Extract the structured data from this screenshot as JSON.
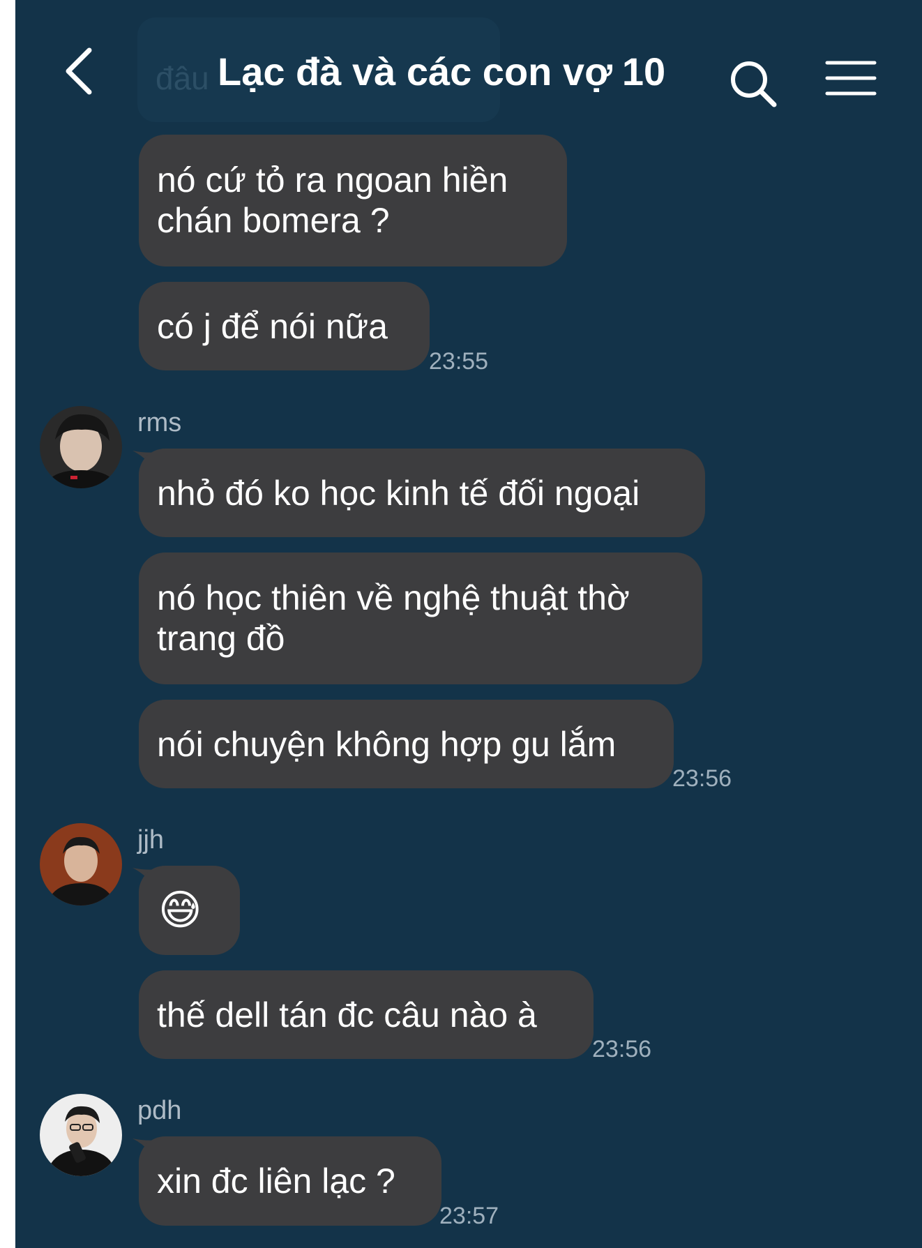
{
  "header": {
    "back_icon": "chevron-left-icon",
    "title": "Lạc đà và các con vợ",
    "member_count": "10",
    "search_icon": "search-icon",
    "menu_icon": "hamburger-menu-icon",
    "ghost_preview": "đâu"
  },
  "messages": [
    {
      "text_lines": [
        "nó cứ tỏ ra ngoan hiền",
        "chán bomera ?"
      ]
    },
    {
      "text_lines": [
        "có j để nói nữa"
      ],
      "time": "23:55"
    },
    {
      "sender": "rms",
      "text_lines": [
        "nhỏ đó ko học kinh tế đối ngoại"
      ]
    },
    {
      "text_lines": [
        "nó học thiên về nghệ thuật thờ",
        "trang đồ"
      ]
    },
    {
      "text_lines": [
        "nói chuyện không hợp gu lắm"
      ],
      "time": "23:56"
    },
    {
      "sender": "jjh",
      "emoji": "😅"
    },
    {
      "text_lines": [
        "thế dell tán đc câu nào à"
      ],
      "time": "23:56"
    },
    {
      "sender": "pdh",
      "text_lines": [
        "xin đc liên lạc ?"
      ],
      "time": "23:57"
    }
  ],
  "colors": {
    "background": "#133349",
    "bubble": "#3d3d3f",
    "text": "#ffffff",
    "timestamp": "#9fb0bd"
  }
}
